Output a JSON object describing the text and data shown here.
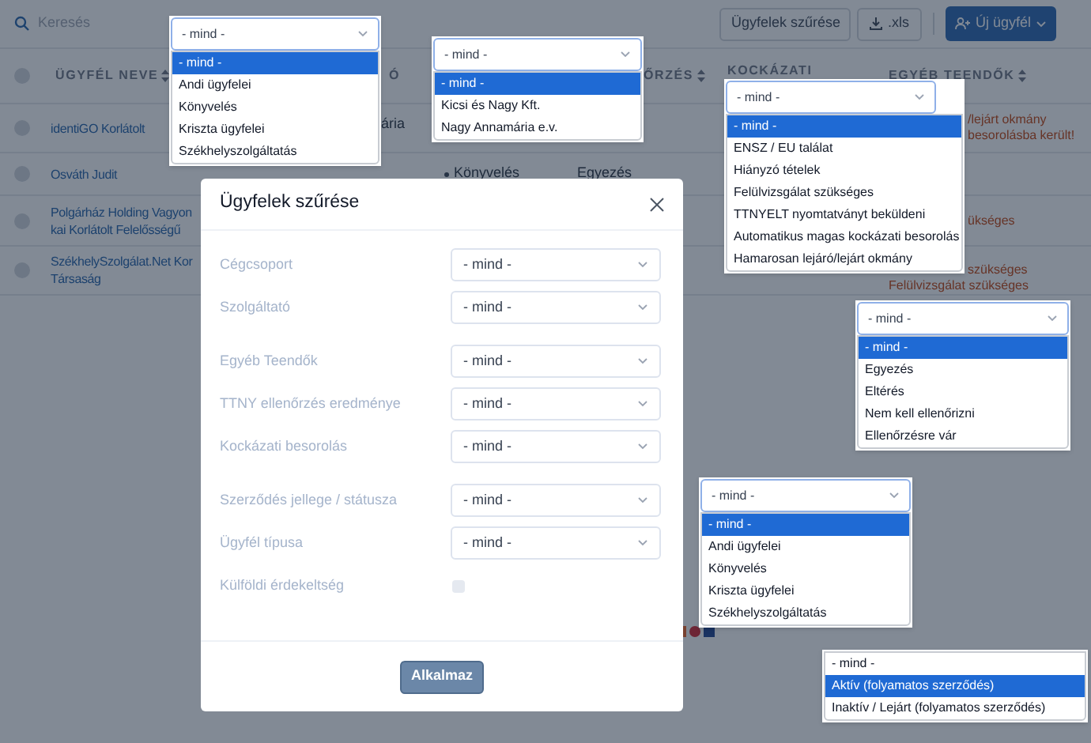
{
  "header": {
    "search_placeholder": "Keresés",
    "buttons": [
      {
        "label": "Ügyfelek szűrése",
        "kind": "outline"
      },
      {
        "label": ".xls",
        "kind": "download"
      },
      {
        "label": "Új ügyfél",
        "kind": "primary"
      }
    ]
  },
  "table": {
    "select_all_checked": false,
    "columns": [
      {
        "label": "ÜGYFÉL NEVE",
        "sortable": true
      },
      {
        "label": "Ó",
        "sortable": false
      },
      {
        "label": "ŐRZÉS",
        "sortable": true
      },
      {
        "label": "KOCKÁZATI",
        "sortable": false
      },
      {
        "label": "EGYÉB TEENDŐK",
        "sortable": true
      }
    ],
    "rows": [
      {
        "checked": false,
        "name": [
          "identiGO Korlátolt"
        ],
        "provider": "ária",
        "tasks": [
          "/lejárt okmány",
          "besorolásba került!"
        ]
      },
      {
        "checked": false,
        "name": [
          "Osváth Judit"
        ],
        "group": "Könyvelés",
        "ttny": "Egyezés"
      },
      {
        "checked": false,
        "name": [
          "Polgárház Holding Vagyon",
          "kai Korlátolt Felelősségű"
        ],
        "tasks": [
          "ükséges"
        ]
      },
      {
        "checked": false,
        "name": [
          "SzékhelySzolgálat.Net Kor",
          "Társaság"
        ],
        "tasks": [
          "szükséges",
          "Felülvizsgálat szükséges"
        ]
      }
    ]
  },
  "modal": {
    "title": "Ügyfelek szűrése",
    "groups": [
      [
        {
          "kind": "select",
          "label": "Cégcsoport",
          "value": "- mind -"
        },
        {
          "kind": "select",
          "label": "Szolgáltató",
          "value": "- mind -"
        }
      ],
      [
        {
          "kind": "select",
          "label": "Egyéb Teendők",
          "value": "- mind -"
        },
        {
          "kind": "select",
          "label": "TTNY ellenőrzés eredménye",
          "value": "- mind -"
        },
        {
          "kind": "select",
          "label": "Kockázati besorolás",
          "value": "- mind -"
        }
      ],
      [
        {
          "kind": "select",
          "label": "Szerződés jellege / státusza",
          "value": "- mind -"
        },
        {
          "kind": "select",
          "label": "Ügyfél típusa",
          "value": "- mind -"
        },
        {
          "kind": "checkbox",
          "label": "Külföldi érdekeltség",
          "checked": false
        }
      ]
    ],
    "apply_button": "Alkalmaz"
  },
  "dropdowns": [
    {
      "value": "- mind -",
      "options": [
        {
          "label": "- mind -",
          "selected": true
        },
        {
          "label": "Andi ügyfelei",
          "selected": false
        },
        {
          "label": "Könyvelés",
          "selected": false
        },
        {
          "label": "Kriszta ügyfelei",
          "selected": false
        },
        {
          "label": "Székhelyszolgáltatás",
          "selected": false
        }
      ]
    },
    {
      "value": "- mind -",
      "options": [
        {
          "label": "- mind -",
          "selected": true
        },
        {
          "label": "Kicsi és Nagy Kft.",
          "selected": false
        },
        {
          "label": "Nagy Annamária e.v.",
          "selected": false
        }
      ]
    },
    {
      "value": "- mind -",
      "options": [
        {
          "label": "- mind -",
          "selected": true
        },
        {
          "label": "ENSZ / EU találat",
          "selected": false
        },
        {
          "label": "Hiányzó tételek",
          "selected": false
        },
        {
          "label": "Felülvizsgálat szükséges",
          "selected": false
        },
        {
          "label": "TTNYELT nyomtatványt beküldeni",
          "selected": false
        },
        {
          "label": "Automatikus magas kockázati besorolás",
          "selected": false
        },
        {
          "label": "Hamarosan lejáró/lejárt okmány",
          "selected": false
        }
      ]
    },
    {
      "value": "- mind -",
      "options": [
        {
          "label": "- mind -",
          "selected": true
        },
        {
          "label": "Egyezés",
          "selected": false
        },
        {
          "label": "Eltérés",
          "selected": false
        },
        {
          "label": "Nem kell ellenőrizni",
          "selected": false
        },
        {
          "label": "Ellenőrzésre vár",
          "selected": false
        }
      ]
    },
    {
      "value": "- mind -",
      "options": [
        {
          "label": "- mind -",
          "selected": true
        },
        {
          "label": "Andi ügyfelei",
          "selected": false
        },
        {
          "label": "Könyvelés",
          "selected": false
        },
        {
          "label": "Kriszta ügyfelei",
          "selected": false
        },
        {
          "label": "Székhelyszolgáltatás",
          "selected": false
        }
      ]
    },
    {
      "options": [
        {
          "label": "- mind -",
          "selected": false
        },
        {
          "label": "Aktív (folyamatos szerződés)",
          "selected": true
        },
        {
          "label": "Inaktív / Lejárt (folyamatos szerződés)",
          "selected": false
        }
      ]
    }
  ]
}
